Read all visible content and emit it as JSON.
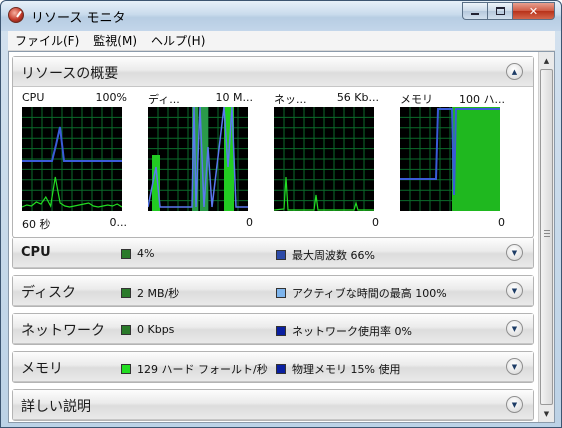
{
  "window": {
    "title": "リソース モニタ"
  },
  "menu": [
    {
      "label": "ファイル(F)"
    },
    {
      "label": "監視(M)"
    },
    {
      "label": "ヘルプ(H)"
    }
  ],
  "overview": {
    "title": "リソースの概要",
    "graphs": [
      {
        "label": "CPU",
        "max": "100%",
        "bottom_left": "60 秒",
        "bottom_right": "0..."
      },
      {
        "label": "ディ...",
        "max": "10 M...",
        "bottom_left": "",
        "bottom_right": "0"
      },
      {
        "label": "ネッ...",
        "max": "56 Kb...",
        "bottom_left": "",
        "bottom_right": "0"
      },
      {
        "label": "メモリ",
        "max": "100 ハ...",
        "bottom_left": "",
        "bottom_right": "0"
      }
    ]
  },
  "sections": [
    {
      "title": "CPU",
      "stat1": "4%",
      "stat1_color": "#2a7a2a",
      "stat2": "最大周波数 66%",
      "stat2_color": "#2c4aa8"
    },
    {
      "title": "ディスク",
      "stat1": "2 MB/秒",
      "stat1_color": "#2a7a2a",
      "stat2": "アクティブな時間の最高 100%",
      "stat2_color": "#7db4ec"
    },
    {
      "title": "ネットワーク",
      "stat1": "0 Kbps",
      "stat1_color": "#2a7a2a",
      "stat2": "ネットワーク使用率 0%",
      "stat2_color": "#0a1fa0"
    },
    {
      "title": "メモリ",
      "stat1": "129 ハード フォールト/秒",
      "stat1_color": "#22dd22",
      "stat2": "物理メモリ 15% 使用",
      "stat2_color": "#0a1fa0"
    },
    {
      "title": "詳しい説明"
    }
  ]
}
